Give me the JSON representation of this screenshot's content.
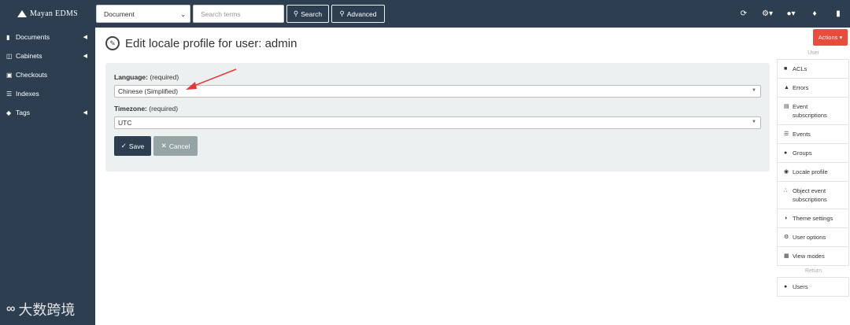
{
  "app": {
    "brand": "Mayan EDMS"
  },
  "navbar": {
    "search_model": "Document",
    "search_placeholder": "Search terms",
    "search_button": "Search",
    "advanced_button": "Advanced"
  },
  "sidebar": {
    "items": [
      {
        "label": "Documents",
        "icon": "book-icon",
        "has_caret": true
      },
      {
        "label": "Cabinets",
        "icon": "columns-icon",
        "has_caret": true
      },
      {
        "label": "Checkouts",
        "icon": "cart-icon",
        "has_caret": false
      },
      {
        "label": "Indexes",
        "icon": "list-icon",
        "has_caret": false
      },
      {
        "label": "Tags",
        "icon": "tag-icon",
        "has_caret": true
      }
    ]
  },
  "main": {
    "page_title": "Edit locale profile for user: admin",
    "form": {
      "language_label": "Language:",
      "language_required": "(required)",
      "language_value": "Chinese (Simplified)",
      "timezone_label": "Timezone:",
      "timezone_required": "(required)",
      "timezone_value": "UTC",
      "save_label": "Save",
      "cancel_label": "Cancel"
    }
  },
  "actions": {
    "button_label": "Actions",
    "user_heading": "User",
    "user_items": [
      {
        "label": "ACLs",
        "icon": "lock-icon"
      },
      {
        "label": "Errors",
        "icon": "warning-icon"
      },
      {
        "label": "Event subscriptions",
        "icon": "event-subscription-icon"
      },
      {
        "label": "Events",
        "icon": "list-ol-icon"
      },
      {
        "label": "Groups",
        "icon": "users-icon"
      },
      {
        "label": "Locale profile",
        "icon": "globe-icon"
      },
      {
        "label": "Object event subscriptions",
        "icon": "rss-icon"
      },
      {
        "label": "Theme settings",
        "icon": "palette-icon"
      },
      {
        "label": "User options",
        "icon": "cog-icon"
      },
      {
        "label": "View modes",
        "icon": "table-icon"
      }
    ],
    "return_heading": "Return",
    "return_items": [
      {
        "label": "Users",
        "icon": "user-icon"
      }
    ]
  },
  "watermark": {
    "text": "大数跨境"
  },
  "colors": {
    "navbar": "#2c3e50",
    "actions": "#e74c3c",
    "panel": "#ecf0f1",
    "cancel": "#95a5a6",
    "arrow": "#e53935"
  }
}
